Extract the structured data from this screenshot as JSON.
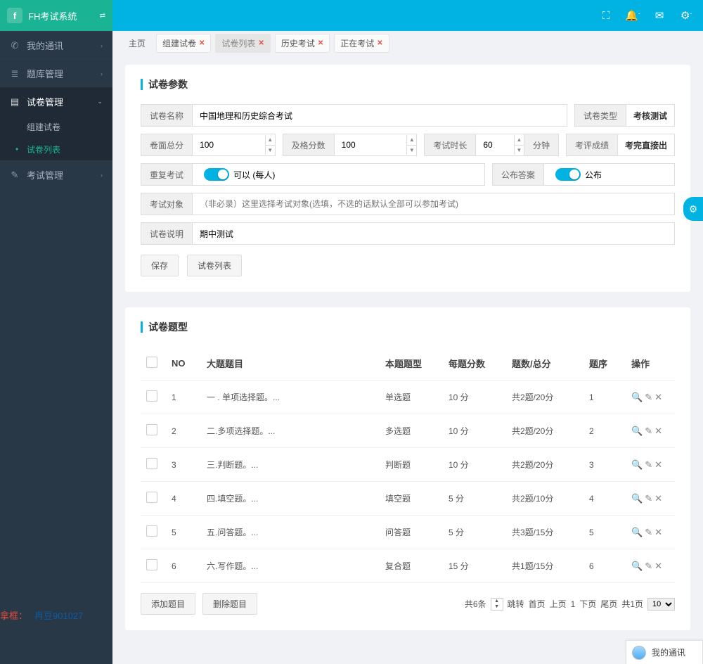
{
  "brand": {
    "logo": "f",
    "title": "FH考试系统"
  },
  "sidebar": {
    "items": [
      {
        "icon": "✆",
        "label": "我的通讯",
        "expand": "›"
      },
      {
        "icon": "≣",
        "label": "题库管理",
        "expand": "›"
      },
      {
        "icon": "▤",
        "label": "试卷管理",
        "expand": "⌄",
        "active": true
      },
      {
        "icon": "✎",
        "label": "考试管理",
        "expand": "›"
      }
    ],
    "sub": [
      {
        "label": "组建试卷"
      },
      {
        "label": "试卷列表",
        "active": true
      }
    ]
  },
  "topicons": [
    "⛶",
    "🔔",
    "✉",
    "⚙"
  ],
  "tabs": {
    "home": "主页",
    "items": [
      {
        "label": "组建试卷",
        "closable": true
      },
      {
        "label": "试卷列表",
        "closable": true,
        "active": true
      },
      {
        "label": "历史考试",
        "closable": true
      },
      {
        "label": "正在考试",
        "closable": true
      }
    ]
  },
  "section1": {
    "title": "试卷参数"
  },
  "form": {
    "name_lbl": "试卷名称",
    "name_val": "中国地理和历史综合考试",
    "type_lbl": "试卷类型",
    "type_val": "考核测试",
    "total_lbl": "卷面总分",
    "total_val": "100",
    "pass_lbl": "及格分数",
    "pass_val": "100",
    "dur_lbl": "考试时长",
    "dur_val": "60",
    "dur_unit": "分钟",
    "grade_lbl": "考评成绩",
    "grade_val": "考完直接出",
    "repeat_lbl": "重复考试",
    "repeat_text": "可以 (每人)",
    "answer_lbl": "公布答案",
    "answer_text": "公布",
    "target_lbl": "考试对象",
    "target_placeholder": "（非必录）这里选择考试对象(选填，不选的话默认全部可以参加考试)",
    "note_lbl": "试卷说明",
    "note_val": "期中测试",
    "save_btn": "保存",
    "list_btn": "试卷列表"
  },
  "section2": {
    "title": "试卷题型"
  },
  "table": {
    "headers": {
      "no": "NO",
      "title": "大题题目",
      "type": "本题题型",
      "score": "每题分数",
      "count": "题数/总分",
      "order": "题序",
      "ops": "操作"
    },
    "rows": [
      {
        "no": "1",
        "title": "一 . 单项选择题。...",
        "type": "单选题",
        "score": "10 分",
        "count": "共2题/20分",
        "order": "1"
      },
      {
        "no": "2",
        "title": "二.多项选择题。...",
        "type": "多选题",
        "score": "10 分",
        "count": "共2题/20分",
        "order": "2"
      },
      {
        "no": "3",
        "title": "三.判断题。...",
        "type": "判断题",
        "score": "10 分",
        "count": "共2题/20分",
        "order": "3"
      },
      {
        "no": "4",
        "title": "四.填空题。...",
        "type": "填空题",
        "score": "5 分",
        "count": "共2题/10分",
        "order": "4"
      },
      {
        "no": "5",
        "title": "五.问答题。...",
        "type": "问答题",
        "score": "5 分",
        "count": "共3题/15分",
        "order": "5"
      },
      {
        "no": "6",
        "title": "六.写作题。...",
        "type": "复合题",
        "score": "15 分",
        "count": "共1题/15分",
        "order": "6"
      }
    ]
  },
  "tfoot": {
    "add": "添加题目",
    "del": "删除题目",
    "total": "共6条",
    "jump": "跳转",
    "first": "首页",
    "prev": "上页",
    "page": "1",
    "next": "下页",
    "last": "尾页",
    "pages": "共1页",
    "size": "10"
  },
  "watermark": {
    "a": "拿框：",
    "b": "冉豆901027"
  },
  "chat": "我的通讯"
}
